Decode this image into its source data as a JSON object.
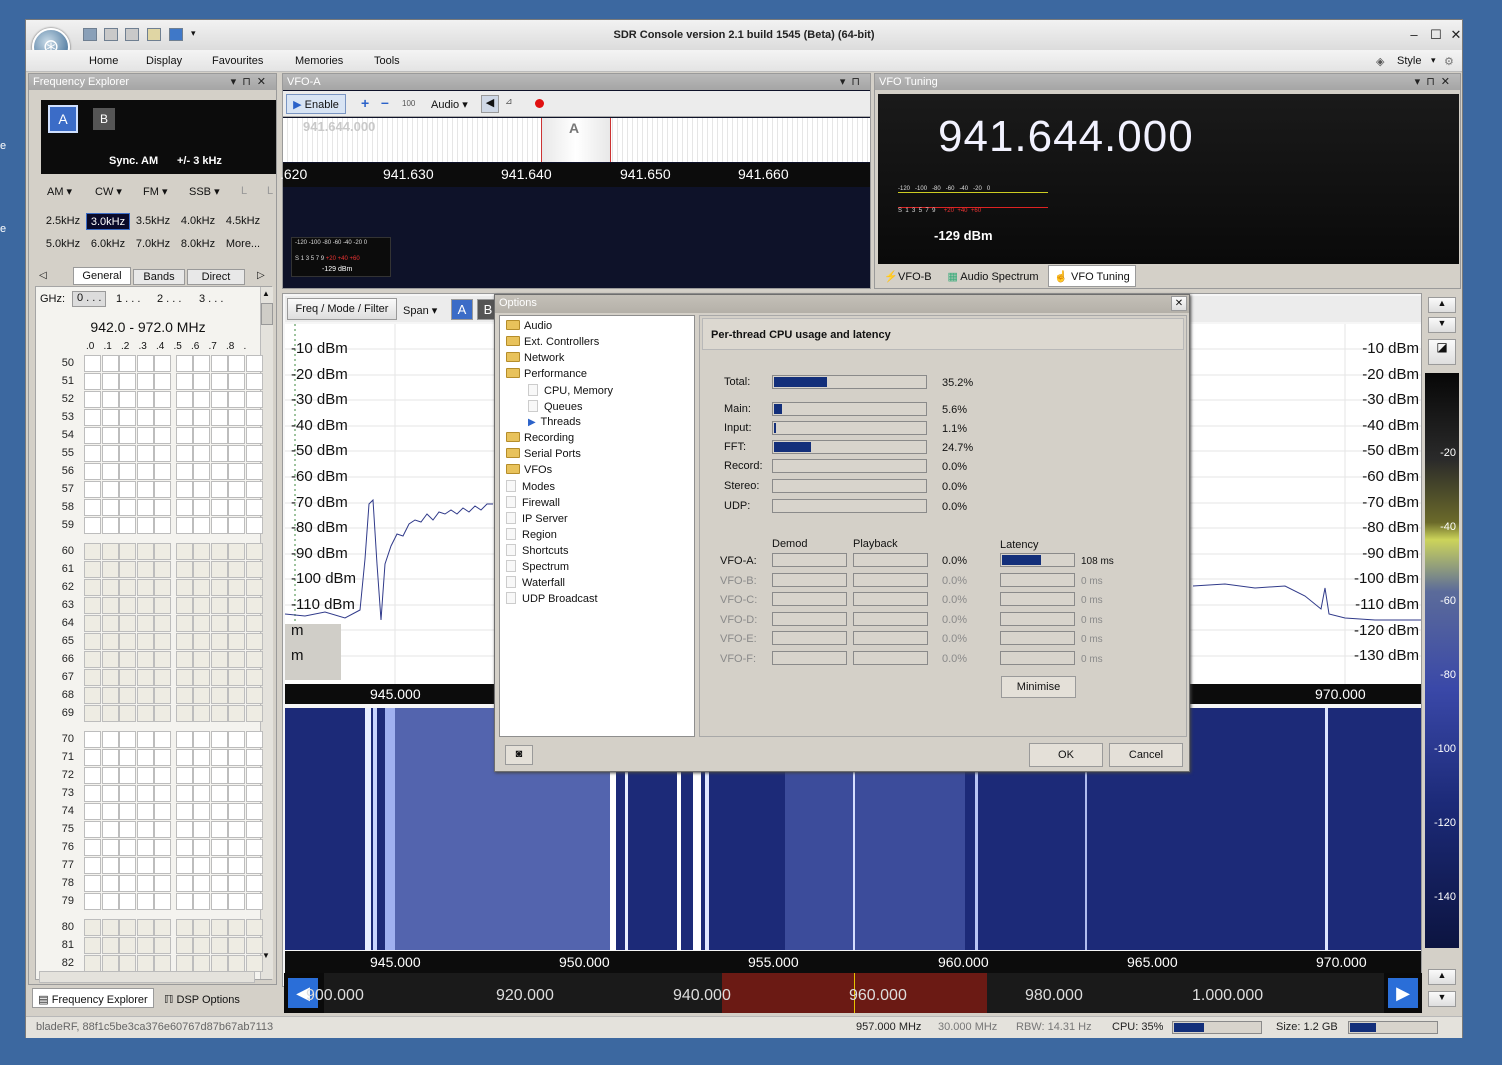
{
  "desktop": {
    "edge_labels": [
      "e",
      "e"
    ]
  },
  "app": {
    "title": "SDR Console version 2.1 build 1545 (Beta) (64-bit)",
    "menu": [
      "Home",
      "Display",
      "Favourites",
      "Memories",
      "Tools"
    ],
    "style_label": "Style"
  },
  "freq_explorer": {
    "title": "Frequency Explorer",
    "vfo_a": "A",
    "vfo_b": "B",
    "mode_text": "Sync. AM",
    "bw_text": "+/- 3 kHz",
    "modes": [
      "AM",
      "CW",
      "FM",
      "SSB",
      "L",
      "L"
    ],
    "filters_row1": [
      "2.5kHz",
      "3.0kHz",
      "3.5kHz",
      "4.0kHz",
      "4.5kHz"
    ],
    "filters_row2": [
      "5.0kHz",
      "6.0kHz",
      "7.0kHz",
      "8.0kHz",
      "More..."
    ],
    "tabs": [
      "General",
      "Bands",
      "Direct"
    ],
    "ghz_label": "GHz:",
    "ghz_tabs": [
      "0 . . .",
      "1 . . .",
      "2 . . .",
      "3 . . ."
    ],
    "range": "942.0 - 972.0 MHz",
    "col_labels": [
      ".0",
      ".1",
      ".2",
      ".3",
      ".4",
      ".5",
      ".6",
      ".7",
      ".8",
      "."
    ],
    "row_labels": [
      "50",
      "51",
      "52",
      "53",
      "54",
      "55",
      "56",
      "57",
      "58",
      "59",
      "60",
      "61",
      "62",
      "63",
      "64",
      "65",
      "66",
      "67",
      "68",
      "69",
      "70",
      "71",
      "72",
      "73",
      "74",
      "75",
      "76",
      "77",
      "78",
      "79",
      "80",
      "81",
      "82"
    ],
    "bottom_tabs": [
      "Frequency Explorer",
      "DSP Options"
    ]
  },
  "vfo_a": {
    "title": "VFO-A",
    "enable": "Enable",
    "step": "100",
    "audio": "Audio",
    "ruler_freq": "941.644.000",
    "scale": [
      ".620",
      "941.630",
      "941.640",
      "941.650",
      "941.660"
    ],
    "meter_ticks": [
      "-120",
      "-100",
      "-80",
      "-60",
      "-40",
      "-20",
      "0"
    ],
    "meter_ticks2": [
      "S",
      "1",
      "3",
      "5",
      "7",
      "9",
      "+20",
      "+40",
      "+60"
    ],
    "meter_value": "-129 dBm"
  },
  "vfo_tuning": {
    "title": "VFO Tuning",
    "freq": "941.644.000",
    "meter_value": "-129 dBm",
    "meter_ticks": [
      "-120",
      "-100",
      "-80",
      "-60",
      "-40",
      "-20",
      "0"
    ],
    "meter_ticks2": [
      "S",
      "1",
      "3",
      "5",
      "7",
      "9",
      "+20",
      "+40",
      "+60"
    ],
    "tabs": [
      "VFO-B",
      "Audio Spectrum",
      "VFO Tuning"
    ]
  },
  "spectrum": {
    "toolbar": [
      "Freq / Mode / Filter",
      "Span",
      "A",
      "B"
    ],
    "dbm_left": [
      "-10 dBm",
      "-20 dBm",
      "-30 dBm",
      "-40 dBm",
      "-50 dBm",
      "-60 dBm",
      "-70 dBm",
      "-80 dBm",
      "-90 dBm",
      "-100 dBm",
      "-110 dBm",
      "m",
      "m"
    ],
    "dbm_right": [
      "-10 dBm",
      "-20 dBm",
      "-30 dBm",
      "-40 dBm",
      "-50 dBm",
      "-60 dBm",
      "-70 dBm",
      "-80 dBm",
      "-90 dBm",
      "-100 dBm",
      "-110 dBm",
      "-120 dBm",
      "-130 dBm"
    ],
    "axis_labels": [
      "945.000",
      "970.000"
    ],
    "wf_axis": [
      "945.000",
      "950.000",
      "955.000",
      "960.000",
      "965.000",
      "970.000"
    ],
    "overview_axis": [
      "900.000",
      "920.000",
      "940.000",
      "960.000",
      "980.000",
      "1.000.000"
    ],
    "colorbar": [
      "-20",
      "-40",
      "-60",
      "-80",
      "-100",
      "-120",
      "-140"
    ]
  },
  "options": {
    "title": "Options",
    "tree": [
      {
        "label": "Audio",
        "kind": "folder",
        "level": 0
      },
      {
        "label": "Ext. Controllers",
        "kind": "folder",
        "level": 0
      },
      {
        "label": "Network",
        "kind": "folder",
        "level": 0
      },
      {
        "label": "Performance",
        "kind": "folder-open",
        "level": 0
      },
      {
        "label": "CPU, Memory",
        "kind": "page",
        "level": 1
      },
      {
        "label": "Queues",
        "kind": "page",
        "level": 1
      },
      {
        "label": "Threads",
        "kind": "selected",
        "level": 1
      },
      {
        "label": "Recording",
        "kind": "folder",
        "level": 0
      },
      {
        "label": "Serial Ports",
        "kind": "folder",
        "level": 0
      },
      {
        "label": "VFOs",
        "kind": "folder",
        "level": 0
      },
      {
        "label": "Modes",
        "kind": "page",
        "level": 0
      },
      {
        "label": "Firewall",
        "kind": "page",
        "level": 0
      },
      {
        "label": "IP Server",
        "kind": "page",
        "level": 0
      },
      {
        "label": "Region",
        "kind": "page",
        "level": 0
      },
      {
        "label": "Shortcuts",
        "kind": "page",
        "level": 0
      },
      {
        "label": "Spectrum",
        "kind": "page",
        "level": 0
      },
      {
        "label": "Waterfall",
        "kind": "page",
        "level": 0
      },
      {
        "label": "UDP Broadcast",
        "kind": "page",
        "level": 0
      }
    ],
    "section_title": "Per-thread CPU usage and latency",
    "cpu": [
      {
        "label": "Total:",
        "pct": 35.2,
        "text": "35.2%"
      },
      {
        "label": "Main:",
        "pct": 5.6,
        "text": "5.6%"
      },
      {
        "label": "Input:",
        "pct": 1.1,
        "text": "1.1%"
      },
      {
        "label": "FFT:",
        "pct": 24.7,
        "text": "24.7%"
      },
      {
        "label": "Record:",
        "pct": 0,
        "text": "0.0%"
      },
      {
        "label": "Stereo:",
        "pct": 0,
        "text": "0.0%"
      },
      {
        "label": "UDP:",
        "pct": 0,
        "text": "0.0%"
      }
    ],
    "col_demod": "Demod",
    "col_playback": "Playback",
    "col_latency": "Latency",
    "vfos": [
      {
        "label": "VFO-A:",
        "pct": "0.0%",
        "latency": "108 ms",
        "lat_frac": 0.55,
        "active": true
      },
      {
        "label": "VFO-B:",
        "pct": "0.0%",
        "latency": "0 ms",
        "lat_frac": 0,
        "active": false
      },
      {
        "label": "VFO-C:",
        "pct": "0.0%",
        "latency": "0 ms",
        "lat_frac": 0,
        "active": false
      },
      {
        "label": "VFO-D:",
        "pct": "0.0%",
        "latency": "0 ms",
        "lat_frac": 0,
        "active": false
      },
      {
        "label": "VFO-E:",
        "pct": "0.0%",
        "latency": "0 ms",
        "lat_frac": 0,
        "active": false
      },
      {
        "label": "VFO-F:",
        "pct": "0.0%",
        "latency": "0 ms",
        "lat_frac": 0,
        "active": false
      }
    ],
    "minimise": "Minimise",
    "ok": "OK",
    "cancel": "Cancel"
  },
  "statusbar": {
    "device": "bladeRF, 88f1c5be3ca376e60767d87b67ab7113",
    "center": "957.000 MHz",
    "span": "30.000 MHz",
    "rbw": "RBW: 14.31 Hz",
    "cpu": "CPU: 35%",
    "cpu_frac": 0.35,
    "size": "Size: 1.2 GB",
    "size_frac": 0.3
  }
}
